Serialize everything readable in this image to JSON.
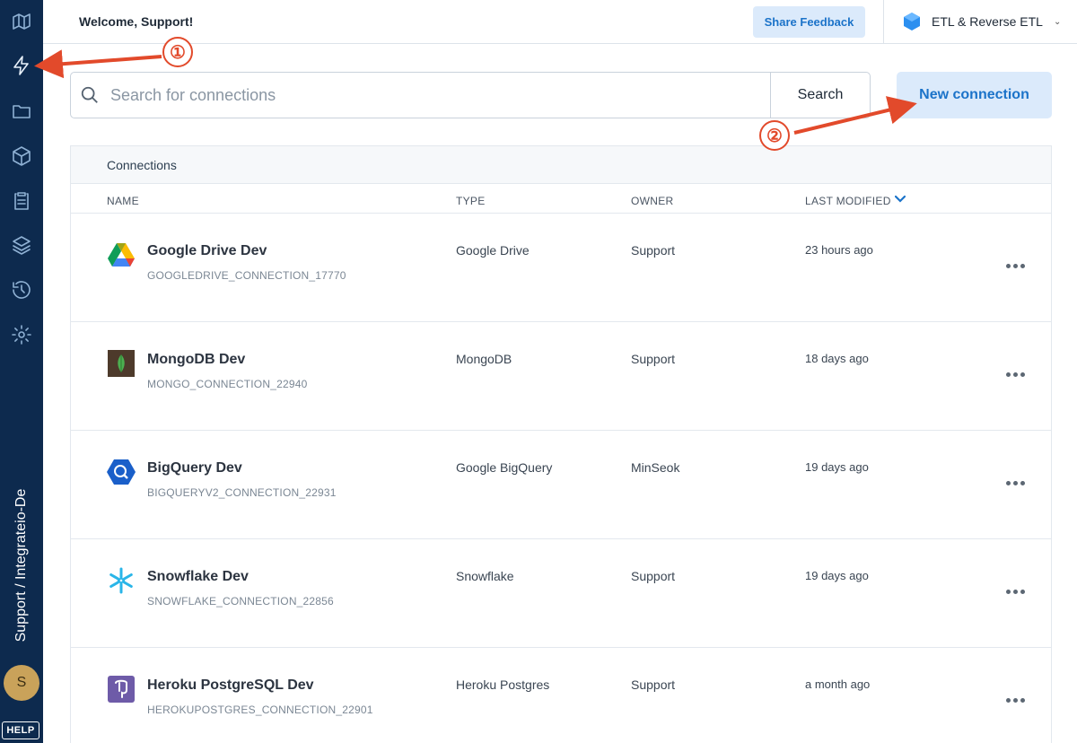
{
  "header": {
    "welcome": "Welcome, Support!",
    "share_feedback": "Share Feedback",
    "product_name": "ETL & Reverse ETL"
  },
  "sidebar": {
    "account_label": "Support / Integrateio-De",
    "avatar_initial": "S",
    "help": "HELP",
    "items": [
      {
        "icon": "logo-icon"
      },
      {
        "icon": "lightning-icon",
        "active": true
      },
      {
        "icon": "folder-icon"
      },
      {
        "icon": "package-icon"
      },
      {
        "icon": "clipboard-icon"
      },
      {
        "icon": "layers-icon"
      },
      {
        "icon": "history-icon"
      },
      {
        "icon": "gear-icon"
      }
    ]
  },
  "search": {
    "placeholder": "Search for connections",
    "value": "",
    "button": "Search"
  },
  "new_connection": "New connection",
  "table": {
    "caption": "Connections",
    "columns": {
      "name": "NAME",
      "type": "TYPE",
      "owner": "OWNER",
      "last_modified": "LAST MODIFIED"
    },
    "rows": [
      {
        "name": "Google Drive Dev",
        "id": "GOOGLEDRIVE_CONNECTION_17770",
        "type": "Google Drive",
        "owner": "Support",
        "modified": "23 hours ago",
        "icon": "google-drive-icon"
      },
      {
        "name": "MongoDB Dev",
        "id": "MONGO_CONNECTION_22940",
        "type": "MongoDB",
        "owner": "Support",
        "modified": "18 days ago",
        "icon": "mongodb-icon"
      },
      {
        "name": "BigQuery Dev",
        "id": "BIGQUERYV2_CONNECTION_22931",
        "type": "Google BigQuery",
        "owner": "MinSeok",
        "modified": "19 days ago",
        "icon": "bigquery-icon"
      },
      {
        "name": "Snowflake Dev",
        "id": "SNOWFLAKE_CONNECTION_22856",
        "type": "Snowflake",
        "owner": "Support",
        "modified": "19 days ago",
        "icon": "snowflake-icon"
      },
      {
        "name": "Heroku PostgreSQL Dev",
        "id": "HEROKUPOSTGRES_CONNECTION_22901",
        "type": "Heroku Postgres",
        "owner": "Support",
        "modified": "a month ago",
        "icon": "postgres-icon"
      }
    ]
  },
  "annotations": {
    "step1": "①",
    "step2": "②"
  },
  "colors": {
    "sidebar": "#0d2a4e",
    "accent": "#1b73c9",
    "accent_bg": "#dbeafb",
    "annotation": "#e24a2b"
  }
}
